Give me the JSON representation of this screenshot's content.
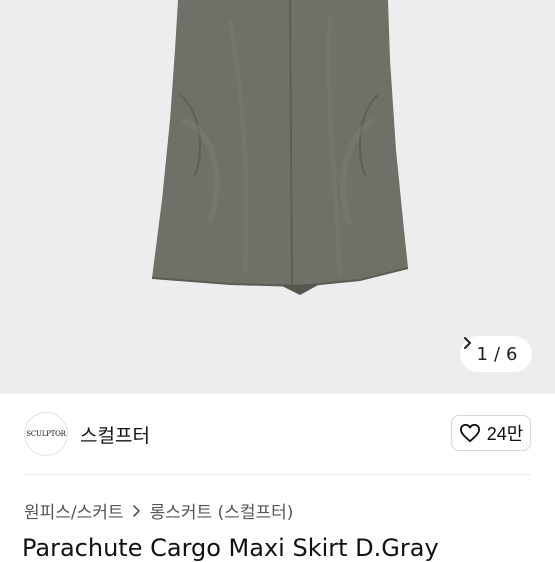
{
  "gallery": {
    "counter_current": "1",
    "counter_separator": "/",
    "counter_total": "6",
    "skirt_color": "#6f7168",
    "background_color": "#ededed"
  },
  "store": {
    "logo_text": "SCULPTOR",
    "name": "스컬프터",
    "like_count": "24만"
  },
  "breadcrumb": {
    "category": "원피스/스커트",
    "subcategory": "롱스커트 (스컬프터)"
  },
  "product": {
    "title": "Parachute Cargo Maxi Skirt D.Gray"
  }
}
